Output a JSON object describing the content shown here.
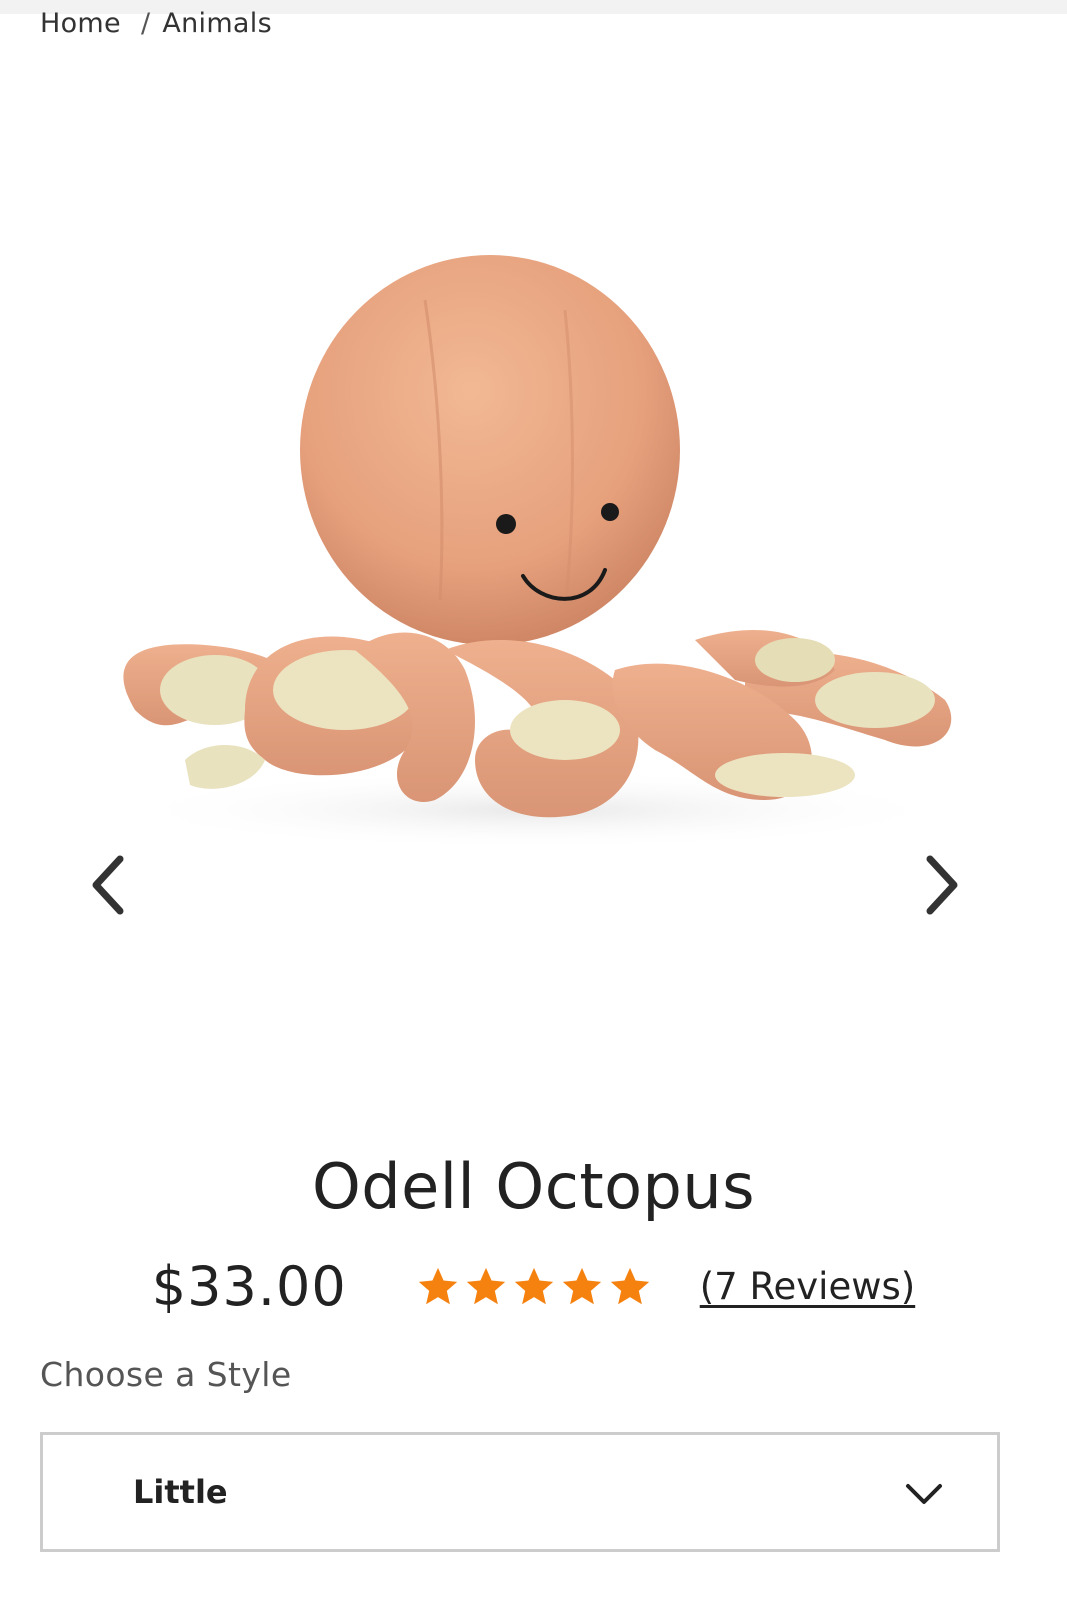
{
  "breadcrumb": {
    "items": [
      "Home",
      "Animals"
    ],
    "separator": "/"
  },
  "gallery": {
    "image_description": "octopus-plush-photo",
    "prev_icon": "chevron-left-icon",
    "next_icon": "chevron-right-icon"
  },
  "product": {
    "title": "Odell Octopus",
    "price": "$33.00",
    "rating": 5,
    "rating_max": 5,
    "reviews_label": "(7 Reviews)",
    "star_color": "#f5820f"
  },
  "style_selector": {
    "label": "Choose a Style",
    "selected": "Little",
    "icon": "chevron-down-icon"
  }
}
